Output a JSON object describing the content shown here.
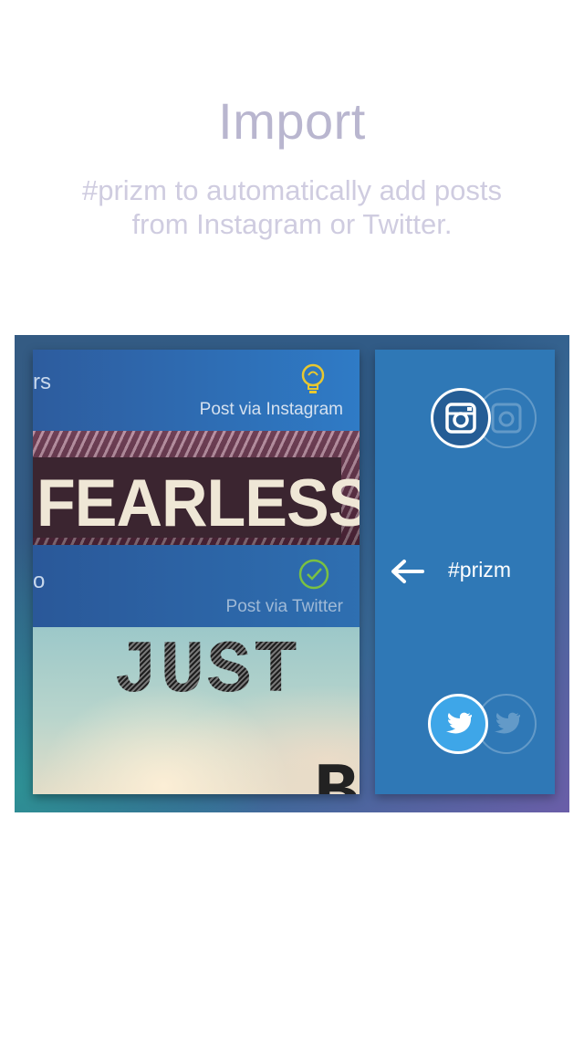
{
  "header": {
    "title": "Import",
    "subtitle_line1": "#prizm to automatically add posts",
    "subtitle_line2": "from Instagram or Twitter."
  },
  "feed": {
    "post1": {
      "cut_text": "rs",
      "status_icon": "lightbulb-icon",
      "via_label": "Post via Instagram",
      "image_text": "FEARLESS"
    },
    "post2": {
      "cut_text": "o",
      "status_icon": "checkmark-icon",
      "via_label": "Post via Twitter",
      "image_text": "JUST",
      "image_text_partial": "B"
    }
  },
  "panel": {
    "hashtag": "#prizm",
    "arrow_icon": "arrow-left-icon",
    "instagram_icon": "instagram-icon",
    "twitter_icon": "twitter-icon"
  },
  "colors": {
    "title": "#b9b6cf",
    "panel": "#2f78b6",
    "twitter_blue": "#3ea6e8",
    "check_green": "#7ac142",
    "bulb_yellow": "#e8c830"
  }
}
